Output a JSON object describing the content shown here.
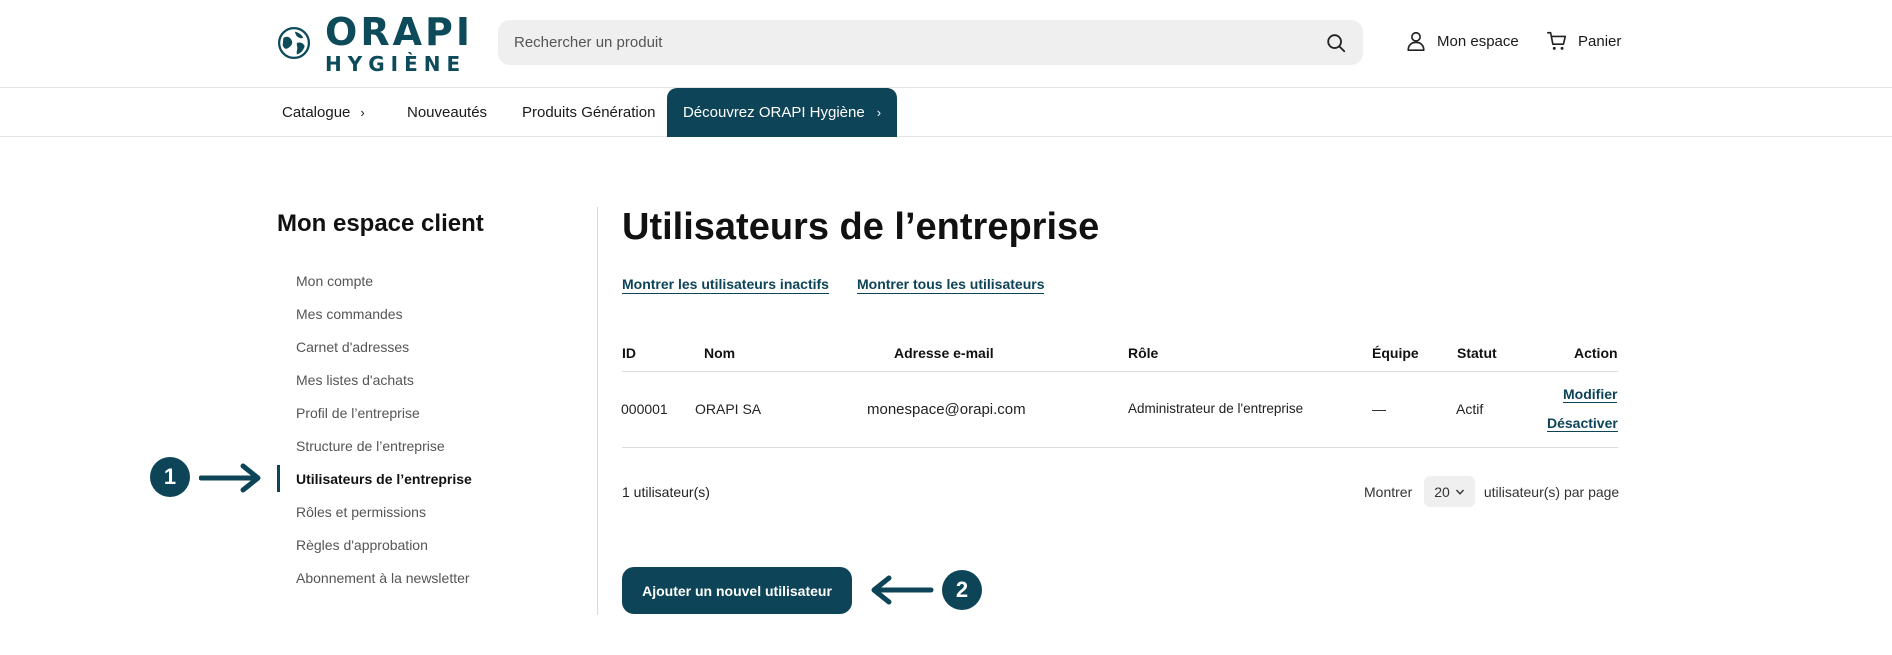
{
  "brand": {
    "name": "ORAPI",
    "subname": "HYGIÈNE",
    "color": "#0d4457"
  },
  "search": {
    "placeholder": "Rechercher un produit",
    "icon": "search-icon"
  },
  "header": {
    "account_label": "Mon espace",
    "account_icon": "user-icon",
    "cart_label": "Panier",
    "cart_icon": "cart-icon"
  },
  "nav": {
    "catalogue": "Catalogue",
    "new": "Nouveautés",
    "generation": "Produits Génération",
    "discover": "Découvrez ORAPI Hygiène"
  },
  "sidebar": {
    "title": "Mon espace client",
    "items": [
      {
        "label": "Mon compte"
      },
      {
        "label": "Mes commandes"
      },
      {
        "label": "Carnet d'adresses"
      },
      {
        "label": "Mes listes d'achats"
      },
      {
        "label": "Profil de l’entreprise"
      },
      {
        "label": "Structure de l’entreprise"
      },
      {
        "label": "Utilisateurs de l’entreprise",
        "active": true
      },
      {
        "label": "Rôles et permissions"
      },
      {
        "label": "Règles d'approbation"
      },
      {
        "label": "Abonnement à la newsletter"
      }
    ]
  },
  "callouts": {
    "one": "1",
    "two": "2"
  },
  "main": {
    "title": "Utilisateurs de l’entreprise",
    "filter_inactive": "Montrer les utilisateurs inactifs",
    "filter_all": "Montrer tous les utilisateurs",
    "columns": {
      "id": "ID",
      "name": "Nom",
      "email": "Adresse e-mail",
      "role": "Rôle",
      "team": "Équipe",
      "status": "Statut",
      "action": "Action"
    },
    "rows": [
      {
        "id": "000001",
        "name": "ORAPI SA",
        "email": "monespace@orapi.com",
        "role": "Administrateur de l'entreprise",
        "team": "—",
        "status": "Actif",
        "edit": "Modifier",
        "disable": "Désactiver"
      }
    ],
    "count": "1 utilisateur(s)",
    "pager": {
      "show": "Montrer",
      "value": "20",
      "suffix": "utilisateur(s) par page"
    },
    "add_button": "Ajouter un nouvel utilisateur"
  }
}
